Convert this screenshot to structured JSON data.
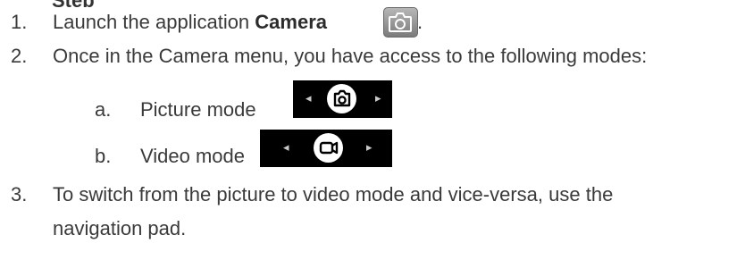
{
  "cut_heading": "Step",
  "steps": [
    {
      "num": "1.",
      "text_before": "Launch the application ",
      "bold": "Camera",
      "text_after": "."
    },
    {
      "num": "2.",
      "text": "Once in the Camera menu, you have access to the following modes:"
    },
    {
      "num": "3.",
      "line1": "To switch from the picture to video mode and vice-versa, use the",
      "line2": "navigation pad."
    }
  ],
  "modes": [
    {
      "letter": "a.",
      "label": "Picture mode",
      "icon": "camera-icon"
    },
    {
      "letter": "b.",
      "label": "Video mode",
      "icon": "video-camera-icon"
    }
  ],
  "arrows": {
    "left": "◂",
    "right": "▸"
  },
  "colors": {
    "text": "#3a3a3a",
    "strip": "#000000",
    "app_icon": "#9a9a9a"
  }
}
